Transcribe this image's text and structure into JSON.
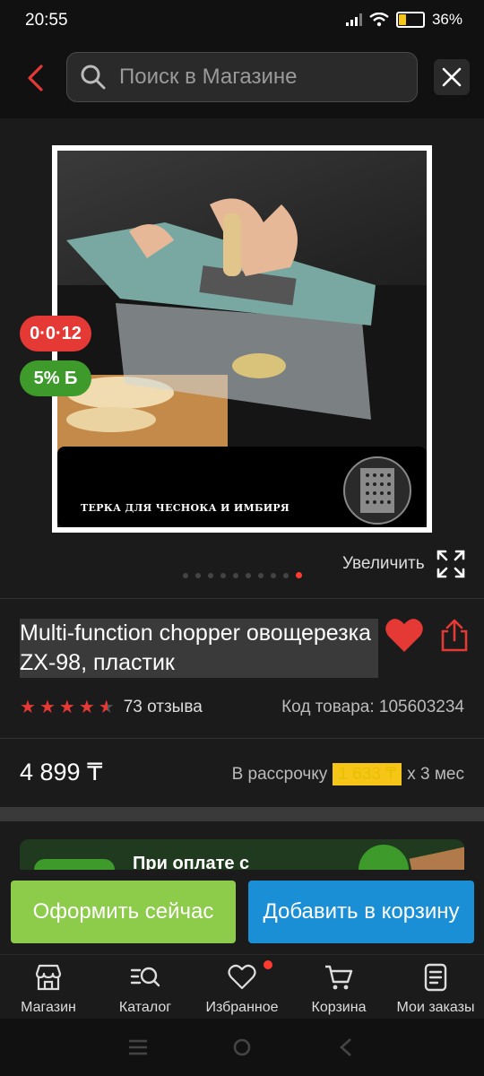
{
  "status_bar": {
    "time": "20:55",
    "battery": "36%"
  },
  "header": {
    "search_placeholder": "Поиск в Магазине"
  },
  "gallery": {
    "image_caption": "ТЕРКА ДЛЯ ЧЕСНОКА И ИМБИРЯ",
    "badge_installment": "0·0·12",
    "badge_bonus": "5% Б",
    "zoom_label": "Увеличить",
    "dots_count": 10,
    "active_dot": 9
  },
  "product": {
    "title": "Multi-function chopper овощерезка ZX-98, пластик",
    "rating": 4.5,
    "reviews": "73 отзыва",
    "code": "Код товара: 105603234",
    "price": "4 899 ₸",
    "installment_prefix": "В рассрочку",
    "installment_amount": "1 633 ₸",
    "installment_suffix": "x 3 мес"
  },
  "promo": {
    "text": "При оплате с"
  },
  "actions": {
    "buy_now": "Оформить сейчас",
    "add_to_cart": "Добавить в корзину"
  },
  "bottom_nav": [
    {
      "label": "Магазин",
      "icon": "store-icon"
    },
    {
      "label": "Каталог",
      "icon": "catalog-search-icon"
    },
    {
      "label": "Избранное",
      "icon": "heart-icon"
    },
    {
      "label": "Корзина",
      "icon": "cart-icon"
    },
    {
      "label": "Мои заказы",
      "icon": "orders-icon"
    }
  ],
  "colors": {
    "accent_red": "#e53935",
    "buy_green": "#8ccc4a",
    "cart_blue": "#1a8fd6",
    "bonus_green": "#3d9a2b"
  }
}
